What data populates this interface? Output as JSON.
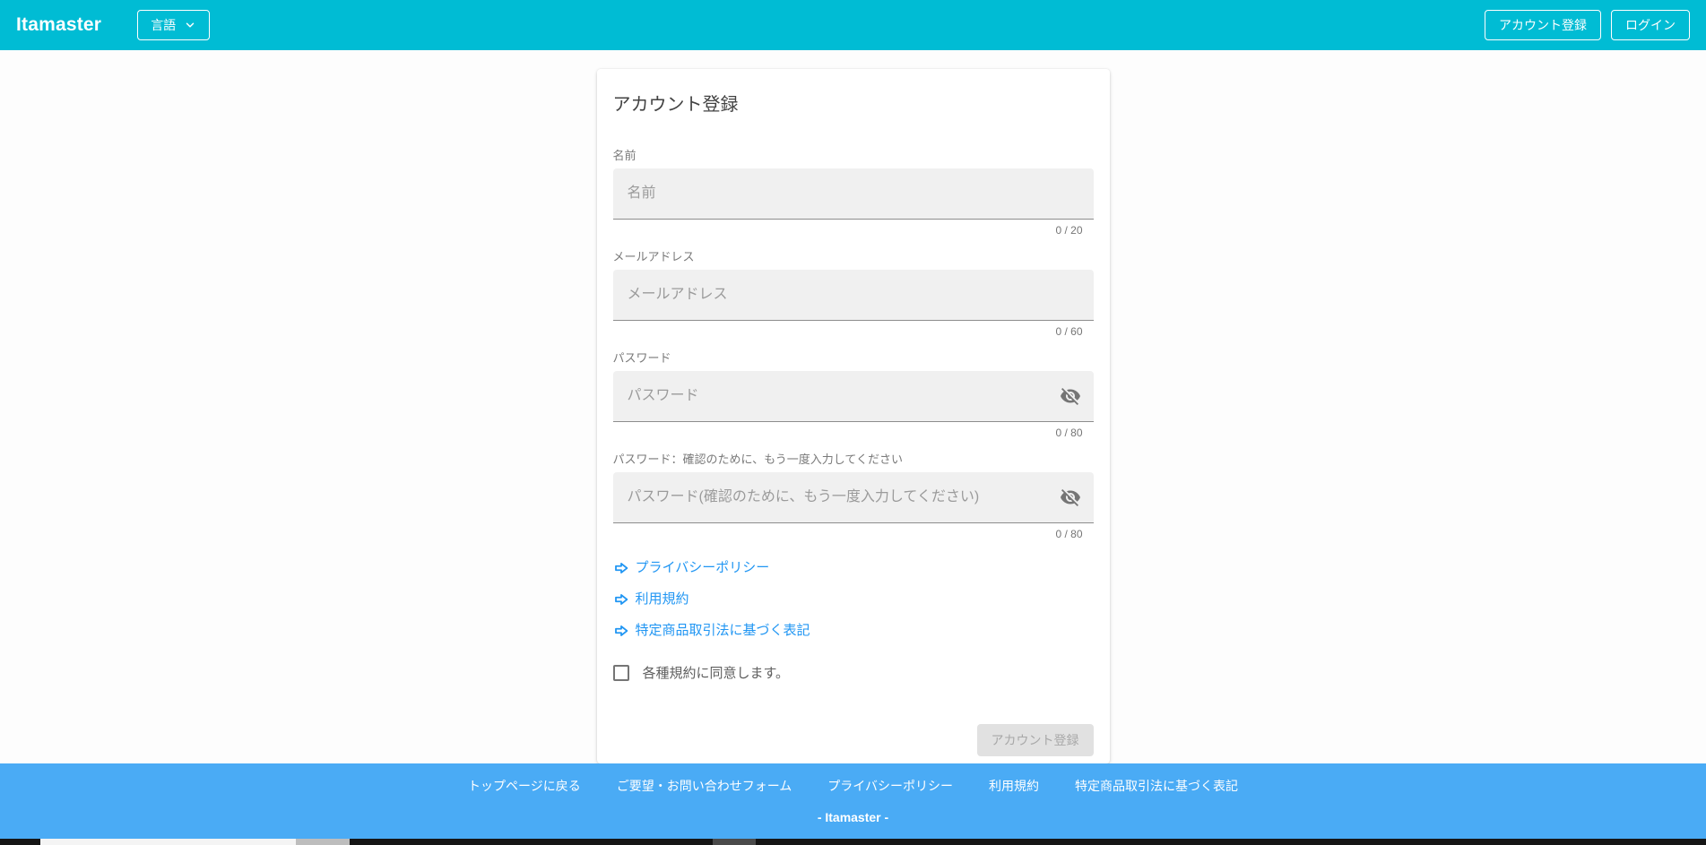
{
  "header": {
    "logo": "Itamaster",
    "language_button": "言語",
    "register_button": "アカウント登録",
    "login_button": "ログイン"
  },
  "card": {
    "title": "アカウント登録",
    "fields": [
      {
        "label": "名前",
        "placeholder": "名前",
        "value": "",
        "counter": "0 / 20"
      },
      {
        "label": "メールアドレス",
        "placeholder": "メールアドレス",
        "value": "",
        "counter": "0 / 60"
      },
      {
        "label": "パスワード",
        "placeholder": "パスワード",
        "value": "",
        "counter": "0 / 80"
      },
      {
        "label": "パスワード：確認のために、もう一度入力してください",
        "placeholder": "パスワード(確認のために、もう一度入力してください)",
        "value": "",
        "counter": "0 / 80"
      }
    ],
    "links": [
      "プライバシーポリシー",
      "利用規約",
      "特定商品取引法に基づく表記"
    ],
    "checkbox_label": "各種規約に同意します。",
    "checkbox_checked": false,
    "submit_button": "アカウント登録",
    "submit_disabled": true
  },
  "footer": {
    "links": [
      "トップページに戻る",
      "ご要望・お問い合わせフォーム",
      "プライバシーポリシー",
      "利用規約",
      "特定商品取引法に基づく表記"
    ],
    "brand": "- Itamaster -"
  },
  "colors": {
    "header_bg": "#00bcd4",
    "footer_bg": "#4aabf5",
    "link_blue": "#2196f3",
    "input_bg": "#f0f0f0",
    "input_underline": "#8d8d8d",
    "disabled_button_bg": "#e1e1e1"
  }
}
